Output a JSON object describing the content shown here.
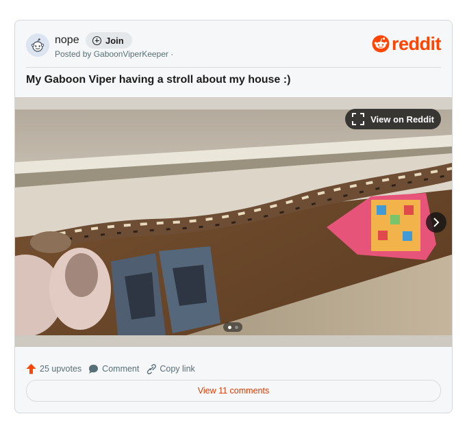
{
  "post": {
    "subreddit": "nope",
    "join_label": "Join",
    "byline": "Posted by GaboonViperKeeper ·",
    "brand": "reddit",
    "title": "My Gaboon Viper having a stroll about my house :)"
  },
  "media": {
    "view_label": "View on Reddit",
    "gallery_count": 2,
    "gallery_active_index": 0
  },
  "actions": {
    "upvotes": "25 upvotes",
    "comment": "Comment",
    "copy_link": "Copy link",
    "view_comments": "View 11 comments"
  },
  "colors": {
    "brand": "#ff4500",
    "upvote": "#ff4500",
    "view_comments": "#d93a00",
    "secondary_text": "#576f76"
  }
}
